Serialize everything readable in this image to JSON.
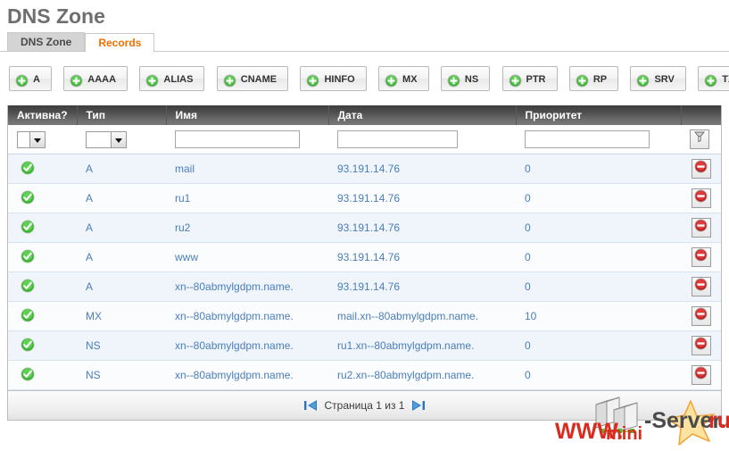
{
  "page": {
    "title": "DNS Zone"
  },
  "tabs": [
    {
      "label": "DNS Zone",
      "state": "inactive"
    },
    {
      "label": "Records",
      "state": "active"
    }
  ],
  "toolbar": {
    "icon": "plus-circle-icon",
    "buttons": [
      {
        "label": "A"
      },
      {
        "label": "AAAA"
      },
      {
        "label": "ALIAS"
      },
      {
        "label": "CNAME"
      },
      {
        "label": "HINFO"
      },
      {
        "label": "MX"
      },
      {
        "label": "NS"
      },
      {
        "label": "PTR"
      },
      {
        "label": "RP"
      },
      {
        "label": "SRV"
      },
      {
        "label": "TXT"
      }
    ]
  },
  "grid": {
    "columns": [
      {
        "key": "active",
        "label": "Активна?"
      },
      {
        "key": "type",
        "label": "Тип"
      },
      {
        "key": "name",
        "label": "Имя"
      },
      {
        "key": "date",
        "label": "Дата"
      },
      {
        "key": "priority",
        "label": "Приоритет"
      },
      {
        "key": "actions",
        "label": ""
      }
    ],
    "filter_row": {
      "active_select_value": "",
      "type_select_value": "",
      "name_input_value": "",
      "name_input_placeholder": "",
      "date_input_value": "",
      "date_input_placeholder": "",
      "priority_input_value": "",
      "priority_input_placeholder": "",
      "filter_button_icon": "funnel-filter-icon"
    },
    "row_icons": {
      "active": "green-check-icon",
      "delete": "red-deny-icon"
    },
    "rows": [
      {
        "active": true,
        "type": "A",
        "name": "mail",
        "date": "93.191.14.76",
        "priority": "0"
      },
      {
        "active": true,
        "type": "A",
        "name": "ru1",
        "date": "93.191.14.76",
        "priority": "0"
      },
      {
        "active": true,
        "type": "A",
        "name": "ru2",
        "date": "93.191.14.76",
        "priority": "0"
      },
      {
        "active": true,
        "type": "A",
        "name": "www",
        "date": "93.191.14.76",
        "priority": "0"
      },
      {
        "active": true,
        "type": "A",
        "name": "xn--80abmylgdpm.name.",
        "date": "93.191.14.76",
        "priority": "0"
      },
      {
        "active": true,
        "type": "MX",
        "name": "xn--80abmylgdpm.name.",
        "date": "mail.xn--80abmylgdpm.name.",
        "priority": "10"
      },
      {
        "active": true,
        "type": "NS",
        "name": "xn--80abmylgdpm.name.",
        "date": "ru1.xn--80abmylgdpm.name.",
        "priority": "0"
      },
      {
        "active": true,
        "type": "NS",
        "name": "xn--80abmylgdpm.name.",
        "date": "ru2.xn--80abmylgdpm.name.",
        "priority": "0"
      }
    ],
    "footer": {
      "first_page_icon": "first-page-arrow-icon",
      "page_text": "Страница 1 из 1",
      "last_page_icon": "last-page-arrow-icon"
    }
  },
  "watermark": {
    "text_www": "WWW.",
    "text_mini": "mini",
    "text_server": "-Server.",
    "text_ru": "ru"
  },
  "colors": {
    "title": "#6f6f6f",
    "active_tab_text": "#f07000",
    "link": "#4a7ebb",
    "header_bg_dark": "#3d3d3d",
    "row_odd": "#eff5fb",
    "row_even": "#fbfcfd",
    "green": "#3bab2e",
    "red": "#cc1f1f"
  }
}
